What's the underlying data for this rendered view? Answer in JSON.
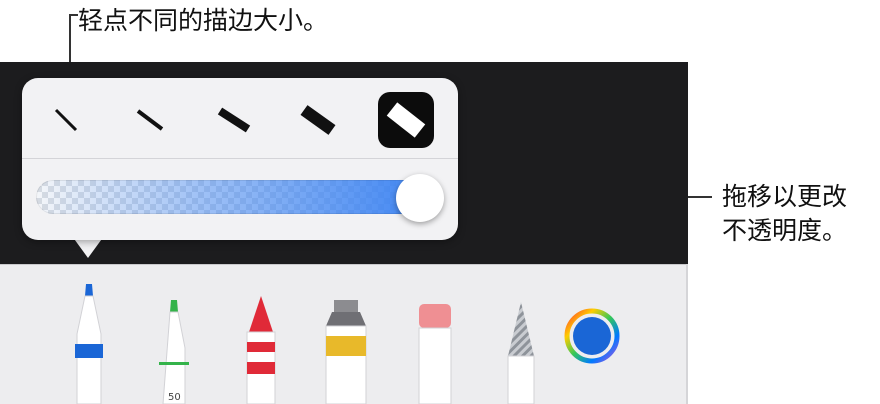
{
  "callouts": {
    "stroke_size": "轻点不同的描边大小。",
    "opacity_line1": "拖移以更改",
    "opacity_line2": "不透明度。"
  },
  "popover": {
    "stroke_sizes": [
      "stroke-size-1",
      "stroke-size-2",
      "stroke-size-3",
      "stroke-size-4",
      "stroke-size-5"
    ],
    "selected_stroke_index": 4,
    "opacity_value": 1.0,
    "ink_color": "#3a82f2"
  },
  "tools": {
    "pen": {
      "icon": "pen-icon",
      "color": "#1a66d6"
    },
    "monoline": {
      "icon": "monoline-icon",
      "color": "#34b34a",
      "label": "50"
    },
    "crayon": {
      "icon": "crayon-icon",
      "color": "#e02a38"
    },
    "paint": {
      "icon": "paint-tube-icon",
      "color": "#e8b92a"
    },
    "eraser": {
      "icon": "eraser-icon",
      "color": "#ef8f93"
    },
    "pencil": {
      "icon": "pencil-icon",
      "color": "#9aa0a6"
    },
    "color_picker": {
      "icon": "color-wheel-icon",
      "color": "#1a66d6"
    }
  }
}
